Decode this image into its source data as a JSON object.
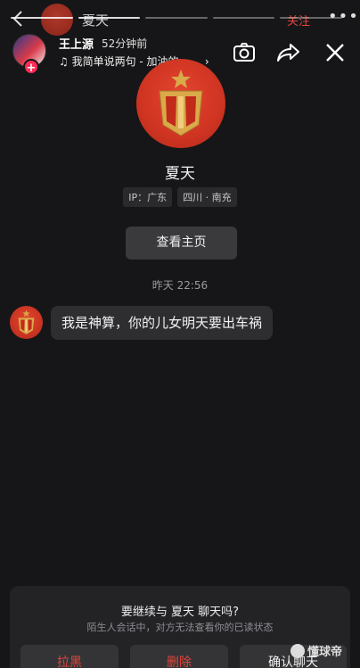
{
  "chat_header": {
    "title": "夏天",
    "follow_label": "关注",
    "more_label": "•••"
  },
  "story": {
    "username": "王上源",
    "time_ago": "52分钟前",
    "music": "♫ 我简单说两句 - 加油的...",
    "progress_segments": 5,
    "progress_done": 2
  },
  "profile": {
    "name": "夏天",
    "tags": [
      "IP：广东",
      "四川 · 南充"
    ],
    "home_button": "查看主页"
  },
  "conversation": {
    "timestamp": "昨天 22:56",
    "messages": [
      {
        "sender": "夏天",
        "text": "我是神算，你的儿女明天要出车祸"
      }
    ]
  },
  "stranger_panel": {
    "title": "要继续与 夏天 聊天吗?",
    "subtitle": "陌生人会话中，对方无法查看你的已读状态",
    "block_label": "拉黑",
    "delete_label": "删除",
    "confirm_label": "确认聊天"
  },
  "watermark": "懂球帝",
  "colors": {
    "background": "#161618",
    "accent_red": "#e0443a",
    "emblem_red": "#cf3422",
    "emblem_gold": "#d9a94a"
  }
}
